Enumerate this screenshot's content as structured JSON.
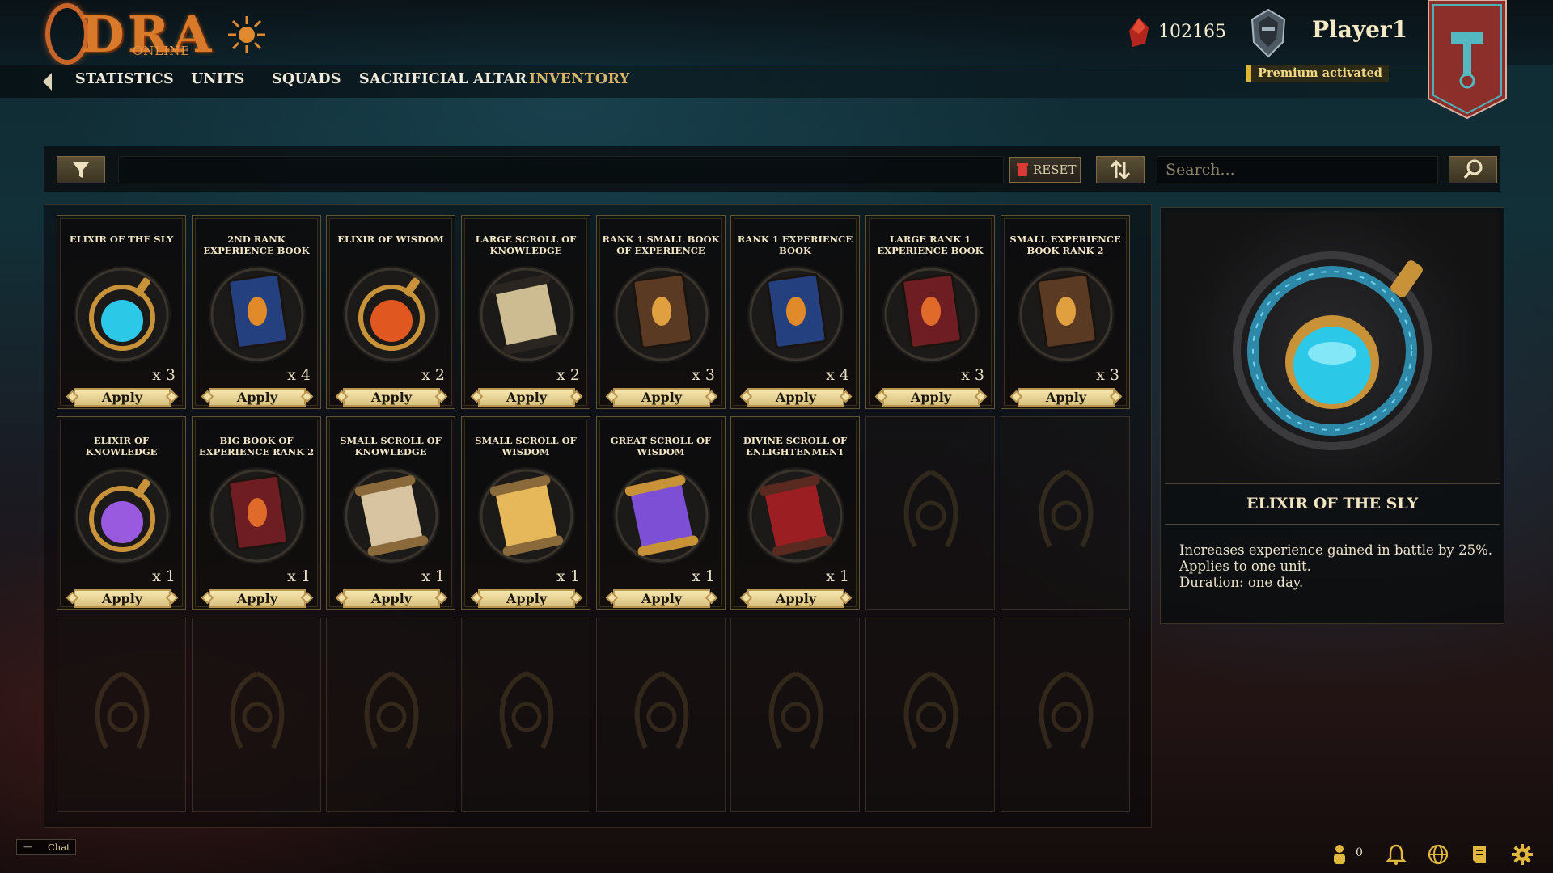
{
  "logo": {
    "text": "DRA",
    "sub": "ONLINE"
  },
  "nav": {
    "tabs": [
      {
        "label": "STATISTICS",
        "active": false
      },
      {
        "label": "UNITS",
        "active": false
      },
      {
        "label": "SQUADS",
        "active": false
      },
      {
        "label": "SACRIFICIAL ALTAR",
        "active": false
      },
      {
        "label": "INVENTORY",
        "active": true
      }
    ]
  },
  "header": {
    "currency": "102165",
    "player_name": "Player1",
    "premium": "Premium activated"
  },
  "toolbar": {
    "reset_label": "RESET",
    "search_placeholder": "Search..."
  },
  "inventory": {
    "apply_label": "Apply",
    "items": [
      {
        "name": "ELIXIR OF THE SLY",
        "qty": "x 3",
        "icon": "elixir-blue-icon"
      },
      {
        "name": "2ND RANK EXPERIENCE BOOK",
        "qty": "x 4",
        "icon": "book-blue-icon"
      },
      {
        "name": "ELIXIR OF WISDOM",
        "qty": "x 2",
        "icon": "elixir-orange-icon"
      },
      {
        "name": "LARGE SCROLL OF KNOWLEDGE",
        "qty": "x 2",
        "icon": "scroll-large-icon"
      },
      {
        "name": "RANK 1 SMALL BOOK OF EXPERIENCE",
        "qty": "x 3",
        "icon": "book-brown-icon"
      },
      {
        "name": "RANK 1 EXPERIENCE BOOK",
        "qty": "x 4",
        "icon": "book-blue-icon"
      },
      {
        "name": "LARGE RANK 1 EXPERIENCE BOOK",
        "qty": "x 3",
        "icon": "book-red-icon"
      },
      {
        "name": "SMALL EXPERIENCE BOOK RANK 2",
        "qty": "x 3",
        "icon": "book-brown-icon"
      },
      {
        "name": "ELIXIR OF KNOWLEDGE",
        "qty": "x 1",
        "icon": "elixir-purple-icon"
      },
      {
        "name": "BIG BOOK OF EXPERIENCE RANK 2",
        "qty": "x 1",
        "icon": "book-red-icon"
      },
      {
        "name": "SMALL SCROLL OF KNOWLEDGE",
        "qty": "x 1",
        "icon": "scroll-parchment-icon"
      },
      {
        "name": "SMALL SCROLL OF WISDOM",
        "qty": "x 1",
        "icon": "scroll-gold-icon"
      },
      {
        "name": "GREAT SCROLL OF WISDOM",
        "qty": "x 1",
        "icon": "scroll-purple-icon"
      },
      {
        "name": "DIVINE SCROLL OF ENLIGHTENMENT",
        "qty": "x 1",
        "icon": "scroll-red-icon"
      }
    ]
  },
  "detail": {
    "title": "ELIXIR OF THE SLY",
    "lines": [
      "Increases experience gained in battle by 25%.",
      "Applies to one unit.",
      "Duration: one day."
    ]
  },
  "footer": {
    "chat_label": "Chat",
    "chat_minimize": "—",
    "online_count": "0"
  }
}
